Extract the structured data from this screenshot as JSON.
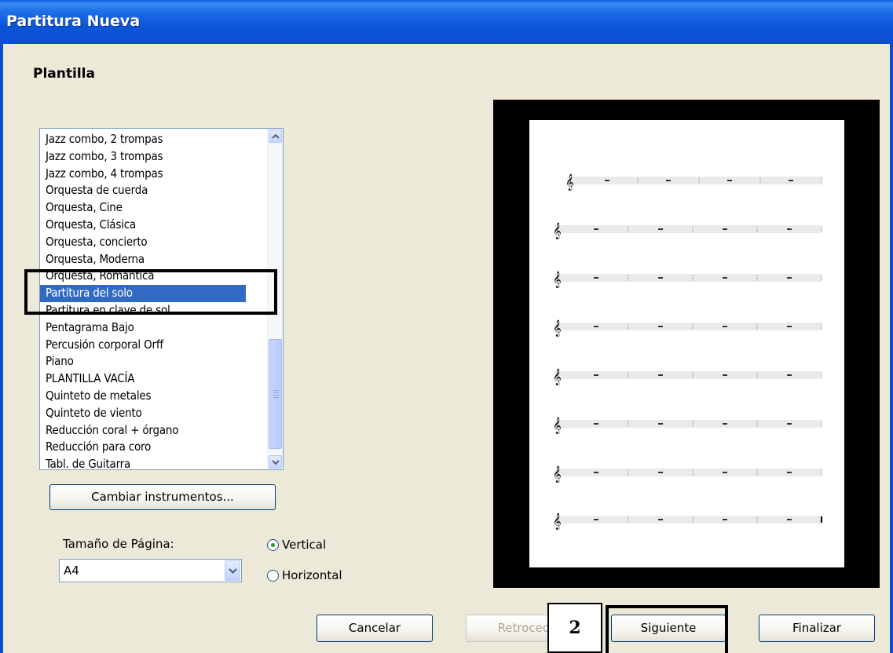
{
  "window": {
    "title": "Partitura Nueva"
  },
  "heading": "Plantilla",
  "template_list": {
    "items": [
      "Jazz combo, 2 trompas",
      "Jazz combo, 3 trompas",
      "Jazz combo, 4 trompas",
      "Orquesta de cuerda",
      "Orquesta, Cine",
      "Orquesta, Clásica",
      "Orquesta, concierto",
      "Orquesta, Moderna",
      "Orquesta, Romántica",
      "Partitura del solo",
      "Partitura en clave de sol",
      "Pentagrama Bajo",
      "Percusión corporal Orff",
      "Piano",
      "PLANTILLA VACÍA",
      "Quinteto de metales",
      "Quinteto de viento",
      "Reducción coral + órgano",
      "Reducción para coro",
      "Tabl. de Guitarra"
    ],
    "selected": "Partitura del solo"
  },
  "buttons": {
    "change_instruments": "Cambiar instrumentos...",
    "cancel": "Cancelar",
    "back": "Retroced",
    "next": "Siguiente",
    "finish": "Finalizar"
  },
  "page_size": {
    "label": "Tamaño de Página:",
    "value": "A4"
  },
  "orientation": {
    "vertical_label": "Vertical",
    "horizontal_label": "Horizontal",
    "selected": "Vertical"
  },
  "annotation": {
    "step_number": "2"
  },
  "colors": {
    "titlebar": "#0a55d8",
    "selection": "#316ac5",
    "dialog_bg": "#ece9d8",
    "radio_dot": "#21a121"
  },
  "icons": [
    "scroll-up-icon",
    "scroll-down-icon",
    "dropdown-arrow-icon",
    "treble-clef-icon"
  ]
}
